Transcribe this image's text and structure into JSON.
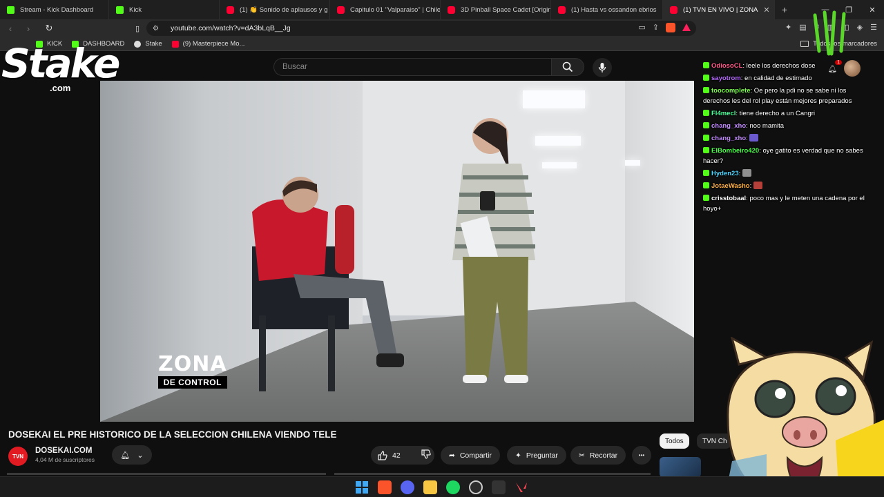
{
  "browser": {
    "tabs": [
      {
        "label": "Stream - Kick Dashboard",
        "icon": "kick-icon",
        "active": false
      },
      {
        "label": "Kick",
        "icon": "kick-icon",
        "active": false
      },
      {
        "label": "(1) 👏 Sonido de aplausos y g",
        "icon": "youtube-icon",
        "active": false
      },
      {
        "label": "Capitulo 01 \"Valparaiso\" | Chile",
        "icon": "youtube-icon",
        "active": false
      },
      {
        "label": "3D Pinball Space Cadet [Origin",
        "icon": "youtube-icon",
        "active": false
      },
      {
        "label": "(1) Hasta vs ossandon ebrios",
        "icon": "youtube-icon",
        "active": false
      },
      {
        "label": "(1) TVN EN VIVO | ZONA",
        "icon": "youtube-icon",
        "active": true
      }
    ],
    "new_tab": "+",
    "url": "youtube.com/watch?v=dA3bLqB__Jg",
    "bookmarks": [
      {
        "label": "KICK",
        "icon": "kick-icon"
      },
      {
        "label": "DASHBOARD",
        "icon": "kick-icon"
      },
      {
        "label": "Stake",
        "icon": "stake-icon"
      },
      {
        "label": "(9) Masterpiece Mo...",
        "icon": "youtube-icon"
      }
    ],
    "bookmarks_folder": "Todos los marcadores"
  },
  "youtube": {
    "search_placeholder": "Buscar",
    "notification_count": "1"
  },
  "overlay": {
    "stake_word": "Stake",
    "stake_domain": ".com",
    "zona_line1": "ZONA",
    "zona_line2": "DE CONTROL"
  },
  "chat": [
    {
      "user": "OdiosoCL",
      "user_color": "#ff5b8a",
      "text": "leele los derechos dose",
      "emote": ""
    },
    {
      "user": "sayotrom",
      "user_color": "#b86bff",
      "text": "en calidad de estimado",
      "emote": ""
    },
    {
      "user": "toocomplete",
      "user_color": "#7dff4d",
      "text": "Oe pero la pdi no se sabe ni los derechos les del rol play están mejores preparados",
      "emote": ""
    },
    {
      "user": "Fl4mecl",
      "user_color": "#4dff9a",
      "text": "tiene derecho a un Cangri",
      "emote": ""
    },
    {
      "user": "chang_xho",
      "user_color": "#c38cff",
      "text": "noo mamita",
      "emote": ""
    },
    {
      "user": "chang_xho",
      "user_color": "#c38cff",
      "text": "",
      "emote": "face-emote"
    },
    {
      "user": "ElBombeiro420",
      "user_color": "#4dff4d",
      "text": "oye gatito es verdad que no sabes hacer?",
      "emote": ""
    },
    {
      "user": "Hyden23",
      "user_color": "#4dd6ff",
      "text": "",
      "emote": "cat-emote"
    },
    {
      "user": "JotaeWasho",
      "user_color": "#ffb347",
      "text": "",
      "emote": "red-emote"
    },
    {
      "user": "crisstobaal",
      "user_color": "#ffffff",
      "text": "poco mas y le meten una cadena por el hoyo+",
      "emote": ""
    }
  ],
  "video_meta": {
    "title": "DOSEKAI EL PRE HISTORICO DE LA SELECCION CHILENA VIENDO TELE",
    "channel_avatar_text": "TVN",
    "channel_name": "DOSEKAI.COM",
    "subscribers": "4,04 M de suscriptores",
    "likes": "42",
    "share_label": "Compartir",
    "ask_label": "Preguntar",
    "clip_label": "Recortar",
    "more_label": "•••",
    "chips": [
      "Todos",
      "TVN Ch"
    ]
  },
  "taskbar": {
    "icons": [
      "windows-start-icon",
      "brave-icon",
      "discord-icon",
      "file-explorer-icon",
      "spotify-icon",
      "obs-icon",
      "app-icon",
      "valorant-icon"
    ]
  },
  "colors": {
    "youtube_red": "#ff0033",
    "kick_green": "#53fc18",
    "background": "#0f0f0f"
  }
}
